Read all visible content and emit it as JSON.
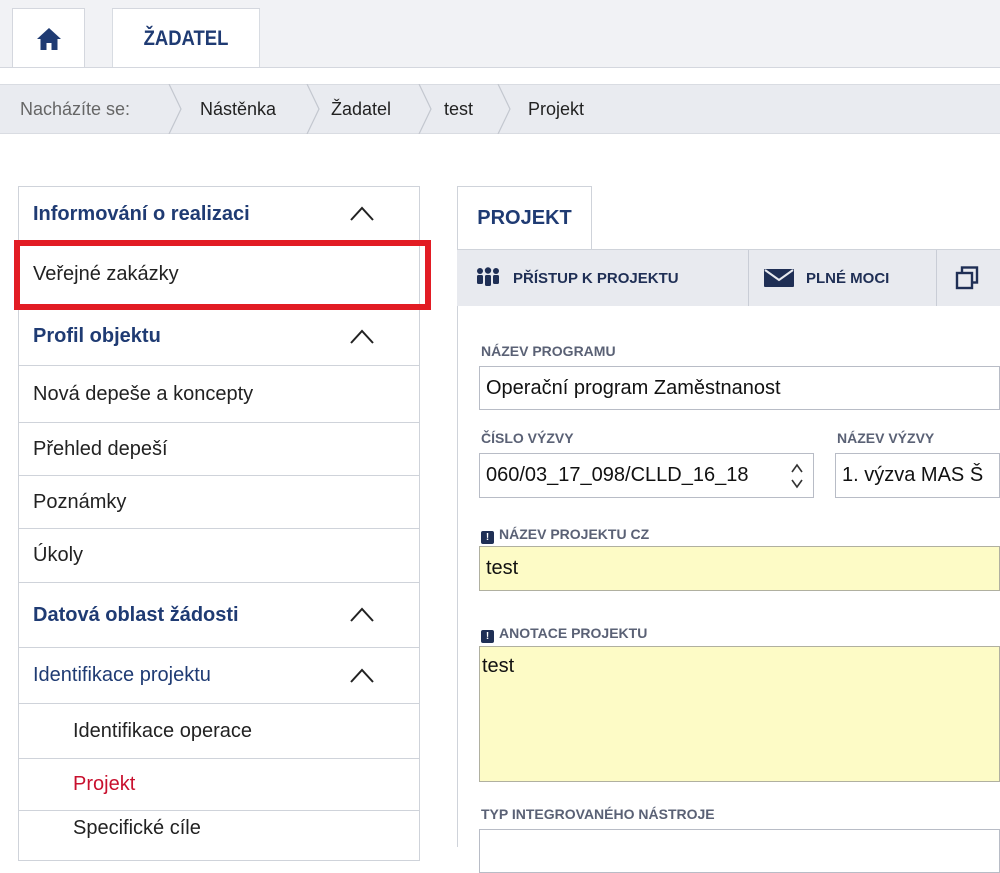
{
  "header": {
    "home_icon": "home-icon",
    "tab_label": "ŽADATEL"
  },
  "breadcrumb": {
    "prefix": "Nacházíte se:",
    "items": [
      "Nástěnka",
      "Žadatel",
      "test",
      "Projekt"
    ]
  },
  "sidebar": {
    "items": [
      {
        "label": "Informování o realizaci"
      },
      {
        "label": "Veřejné zakázky"
      },
      {
        "label": "Profil objektu"
      },
      {
        "label": "Nová depeše a koncepty"
      },
      {
        "label": "Přehled depeší"
      },
      {
        "label": "Poznámky"
      },
      {
        "label": "Úkoly"
      },
      {
        "label": "Datová oblast žádosti"
      },
      {
        "label": "Identifikace projektu"
      },
      {
        "label": "Identifikace operace"
      },
      {
        "label": "Projekt"
      },
      {
        "label": "Specifické cíle"
      }
    ]
  },
  "main": {
    "tab_label": "PROJEKT",
    "toolbar": {
      "access_label": "PŘÍSTUP K PROJEKTU",
      "proxy_label": "PLNÉ MOCI"
    },
    "fields": {
      "program_name_label": "NÁZEV PROGRAMU",
      "program_name_value": "Operační program Zaměstnanost",
      "call_number_label": "ČÍSLO VÝZVY",
      "call_number_value": "060/03_17_098/CLLD_16_18",
      "call_name_label": "NÁZEV VÝZVY",
      "call_name_value": "1. výzva MAS Š",
      "project_name_label": "NÁZEV PROJEKTU CZ",
      "project_name_value": "test",
      "annotation_label": "ANOTACE PROJEKTU",
      "annotation_value": "test",
      "integrated_tool_label": "TYP INTEGROVANÉHO NÁSTROJE"
    }
  },
  "colors": {
    "accent_navy": "#1f3b73",
    "highlight_red": "#e21c24",
    "active_red": "#c8102e",
    "required_yellow": "#fdfbc6"
  }
}
